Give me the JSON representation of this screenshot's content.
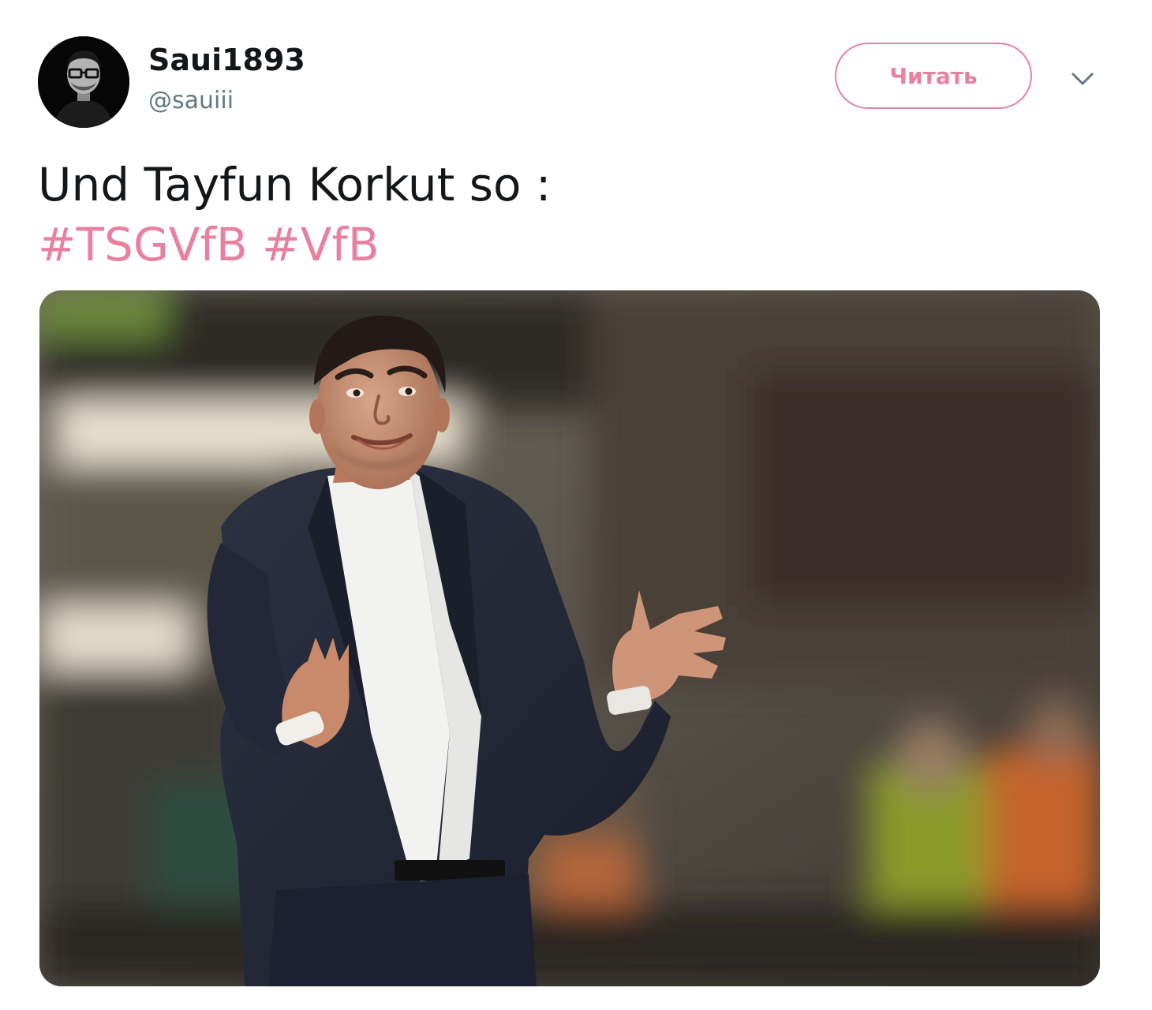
{
  "user": {
    "display_name": "Saui1893",
    "handle": "@sauiii"
  },
  "follow_button": {
    "label": "Читать"
  },
  "tweet": {
    "text": "Und Tayfun Korkut so :",
    "hashtags": [
      "#TSGVfB",
      "#VfB"
    ]
  },
  "colors": {
    "accent": "#e8819f",
    "text": "#14171a",
    "secondary_text": "#657786"
  },
  "icons": {
    "more": "chevron-down-icon"
  }
}
